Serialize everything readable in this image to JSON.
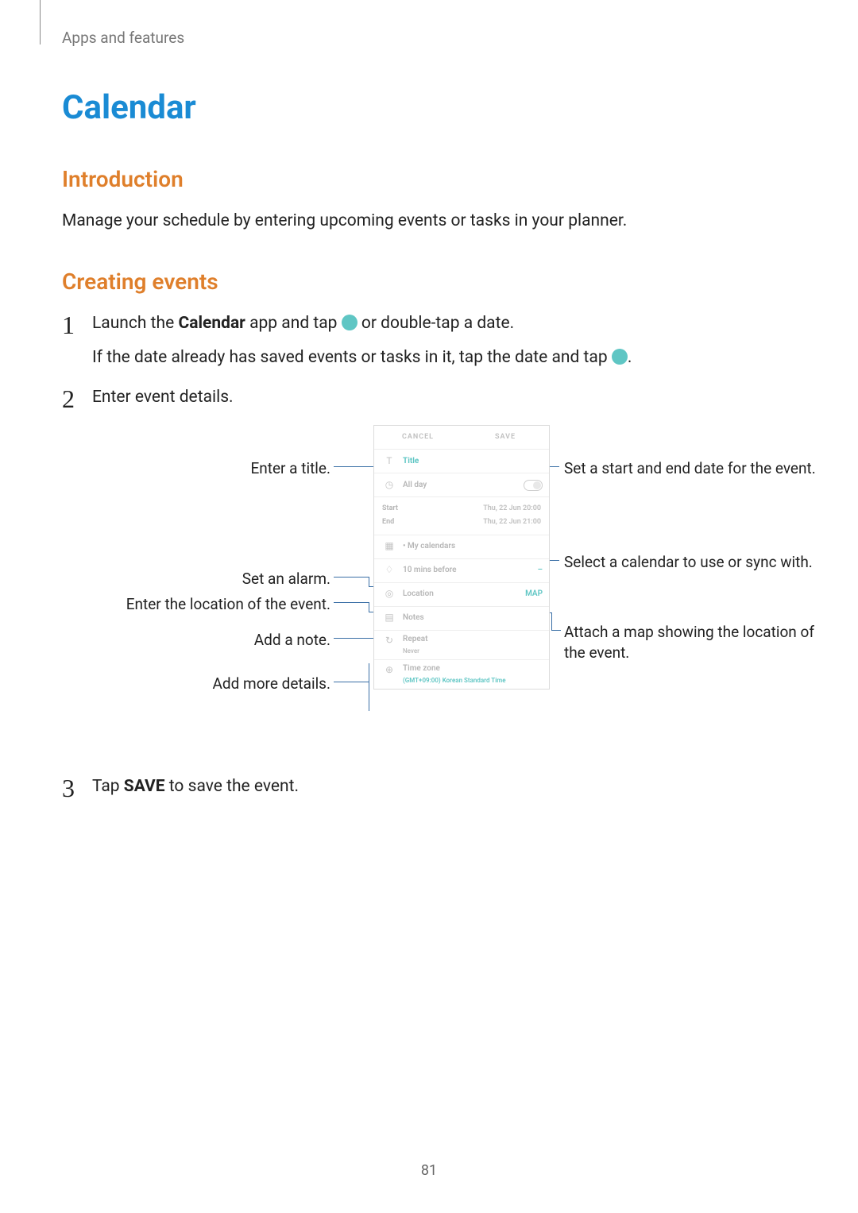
{
  "header": "Apps and features",
  "title": "Calendar",
  "section_intro_heading": "Introduction",
  "intro_text": "Manage your schedule by entering upcoming events or tasks in your planner.",
  "section_creating_heading": "Creating events",
  "steps": {
    "s1a": "Launch the ",
    "s1b": "Calendar",
    "s1c": " app and tap ",
    "s1d": " or double-tap a date.",
    "s1_sub_a": "If the date already has saved events or tasks in it, tap the date and tap ",
    "s1_sub_b": ".",
    "s2": "Enter event details.",
    "s3a": "Tap ",
    "s3b": "SAVE",
    "s3c": " to save the event."
  },
  "callouts": {
    "title": "Enter a title.",
    "alarm": "Set an alarm.",
    "location": "Enter the location of the event.",
    "note": "Add a note.",
    "details": "Add more details.",
    "dates": "Set a start and end date for the event.",
    "calendar": "Select a calendar to use or sync with.",
    "map": "Attach a map showing the location of the event."
  },
  "phone": {
    "cancel": "CANCEL",
    "save": "SAVE",
    "title_placeholder": "Title",
    "allday": "All day",
    "start": "Start",
    "start_val": "Thu, 22 Jun   20:00",
    "end": "End",
    "end_val": "Thu, 22 Jun   21:00",
    "mycal": "• My calendars",
    "alarm": "10 mins before",
    "alarm_right": "–",
    "location": "Location",
    "map": "MAP",
    "notes": "Notes",
    "repeat": "Repeat",
    "repeat_sub": "Never",
    "tz": "Time zone",
    "tz_sub": "(GMT+09:00) Korean Standard Time"
  },
  "page_number": "81"
}
